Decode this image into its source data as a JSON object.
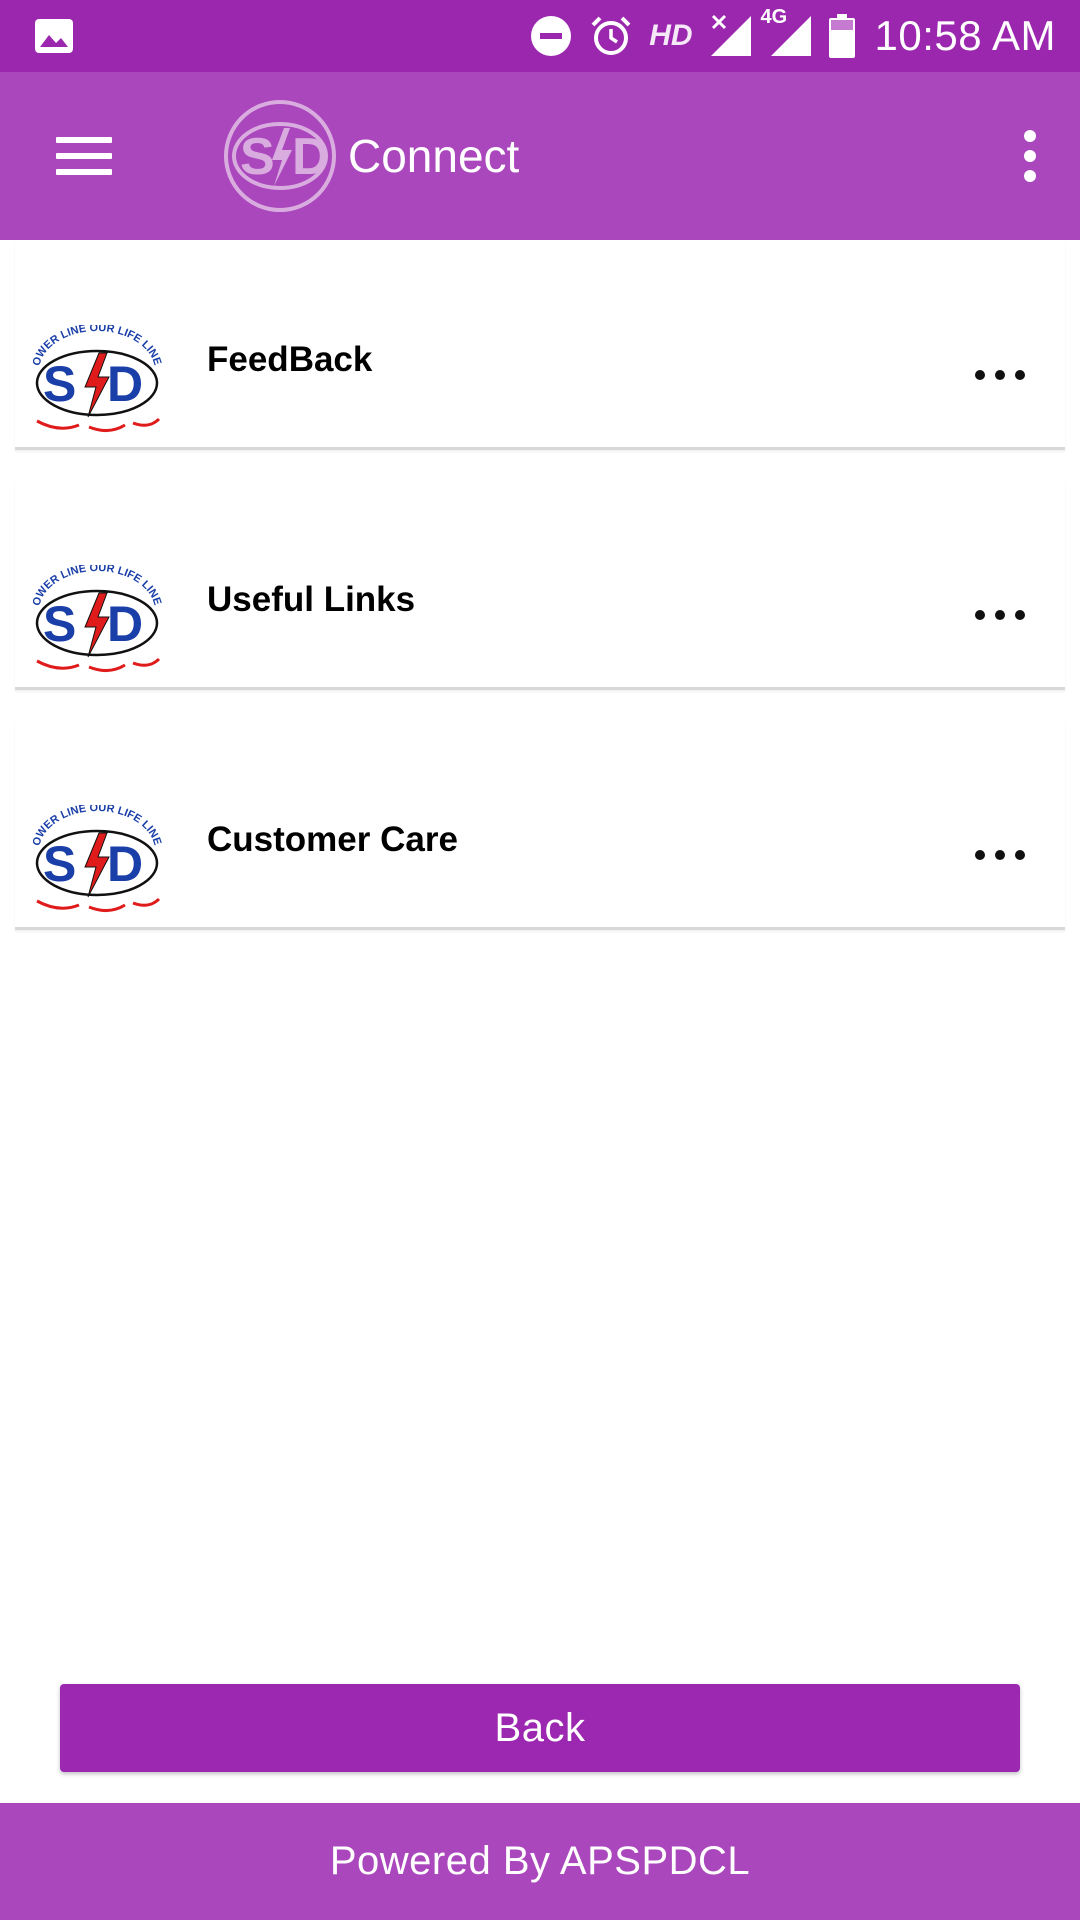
{
  "status_bar": {
    "time": "10:58 AM",
    "network_label": "4G",
    "hd_label": "HD",
    "icons": [
      "image-icon",
      "dnd-icon",
      "alarm-icon",
      "hd-icon",
      "signal-no-service-icon",
      "signal-4g-icon",
      "battery-icon"
    ]
  },
  "app_bar": {
    "title": "Connect",
    "menu_icon": "hamburger-menu-icon",
    "overflow_icon": "overflow-menu-icon",
    "logo": "spdcl-logo"
  },
  "list": {
    "items": [
      {
        "label": "FeedBack"
      },
      {
        "label": "Useful Links"
      },
      {
        "label": "Customer Care"
      }
    ]
  },
  "actions": {
    "back_label": "Back"
  },
  "footer": {
    "text": "Powered By APSPDCL"
  },
  "colors": {
    "status_bar": "#9b27af",
    "app_bar": "#ab47bc",
    "button": "#9c27b0",
    "footer": "#ab47bc",
    "logo_blue": "#1a3fa8",
    "logo_red": "#e01b1b"
  }
}
